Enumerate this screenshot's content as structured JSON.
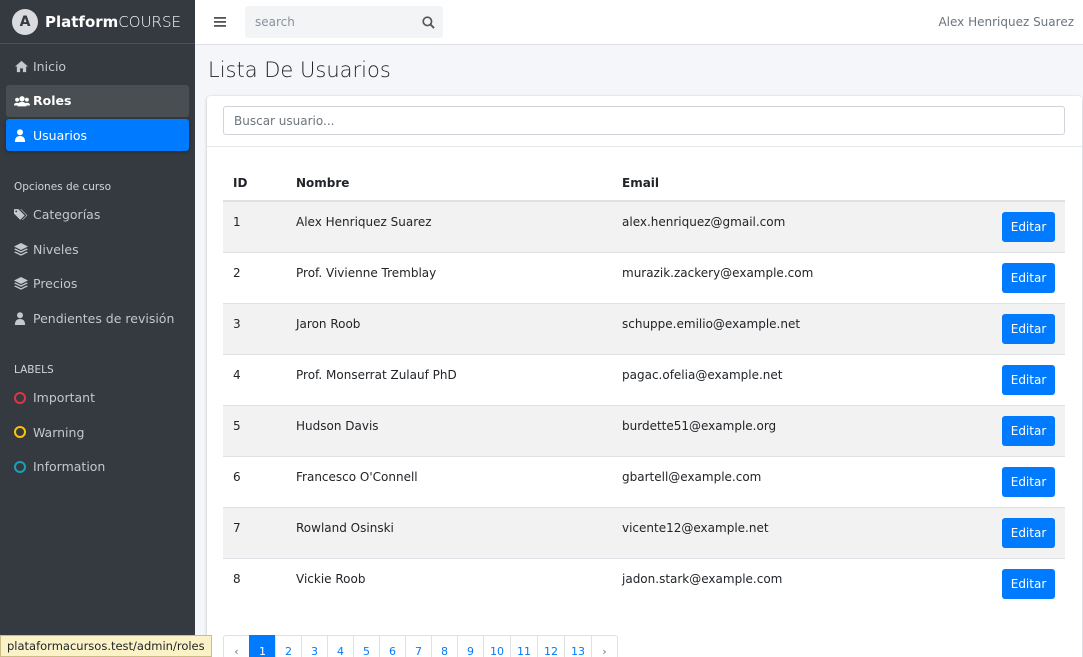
{
  "brand": {
    "name_bold": "Platform",
    "name_rest": "COURSE"
  },
  "sidebar": {
    "items": [
      {
        "label": "Inicio",
        "icon": "home-icon"
      },
      {
        "label": "Roles",
        "icon": "users-icon"
      },
      {
        "label": "Usuarios",
        "icon": "user-icon"
      }
    ],
    "section_course": "Opciones de curso",
    "course_items": [
      {
        "label": "Categorías",
        "icon": "tags-icon"
      },
      {
        "label": "Niveles",
        "icon": "layer-group-icon"
      },
      {
        "label": "Precios",
        "icon": "layer-group-icon"
      },
      {
        "label": "Pendientes de revisión",
        "icon": "user-icon"
      }
    ],
    "section_labels": "LABELS",
    "labels": [
      {
        "label": "Important",
        "color": "#dc3545"
      },
      {
        "label": "Warning",
        "color": "#ffc107"
      },
      {
        "label": "Information",
        "color": "#17a2b8"
      }
    ]
  },
  "topbar": {
    "search_placeholder": "search",
    "user_name": "Alex Henriquez Suarez"
  },
  "main": {
    "title": "Lista De Usuarios",
    "search_placeholder": "Buscar usuario...",
    "table": {
      "headers": {
        "id": "ID",
        "name": "Nombre",
        "email": "Email"
      },
      "edit_label": "Editar",
      "rows": [
        {
          "id": "1",
          "name": "Alex Henriquez Suarez",
          "email": "alex.henriquez@gmail.com"
        },
        {
          "id": "2",
          "name": "Prof. Vivienne Tremblay",
          "email": "murazik.zackery@example.com"
        },
        {
          "id": "3",
          "name": "Jaron Roob",
          "email": "schuppe.emilio@example.net"
        },
        {
          "id": "4",
          "name": "Prof. Monserrat Zulauf PhD",
          "email": "pagac.ofelia@example.net"
        },
        {
          "id": "5",
          "name": "Hudson Davis",
          "email": "burdette51@example.org"
        },
        {
          "id": "6",
          "name": "Francesco O'Connell",
          "email": "gbartell@example.com"
        },
        {
          "id": "7",
          "name": "Rowland Osinski",
          "email": "vicente12@example.net"
        },
        {
          "id": "8",
          "name": "Vickie Roob",
          "email": "jadon.stark@example.com"
        }
      ]
    },
    "pagination": {
      "prev": "‹",
      "pages": [
        "1",
        "2",
        "3",
        "4",
        "5",
        "6",
        "7",
        "8",
        "9",
        "10",
        "11",
        "12",
        "13"
      ],
      "current": "1",
      "next": "›"
    }
  },
  "status_bar": {
    "url": "plataformacursos.test/admin/roles"
  },
  "colors": {
    "sidebar_bg": "#343a40",
    "accent": "#007bff"
  }
}
